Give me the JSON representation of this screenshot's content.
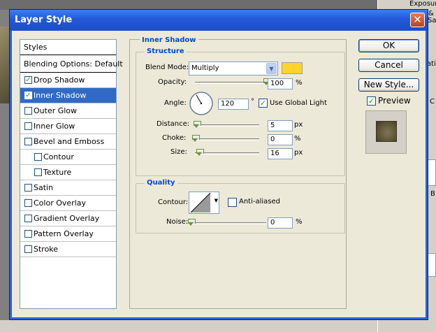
{
  "background": {
    "side_texts": [
      "Exposur",
      "&",
      "Sal",
      "ativ",
      "B",
      "C"
    ]
  },
  "dialog": {
    "title": "Layer Style",
    "close_glyph": "✕"
  },
  "styles_panel": {
    "header": "Styles",
    "blending_options": "Blending Options: Default",
    "items": [
      {
        "label": "Drop Shadow",
        "checked": true,
        "indent": false,
        "selected": false
      },
      {
        "label": "Inner Shadow",
        "checked": true,
        "indent": false,
        "selected": true
      },
      {
        "label": "Outer Glow",
        "checked": false,
        "indent": false,
        "selected": false
      },
      {
        "label": "Inner Glow",
        "checked": false,
        "indent": false,
        "selected": false
      },
      {
        "label": "Bevel and Emboss",
        "checked": false,
        "indent": false,
        "selected": false
      },
      {
        "label": "Contour",
        "checked": false,
        "indent": true,
        "selected": false
      },
      {
        "label": "Texture",
        "checked": false,
        "indent": true,
        "selected": false
      },
      {
        "label": "Satin",
        "checked": false,
        "indent": false,
        "selected": false
      },
      {
        "label": "Color Overlay",
        "checked": false,
        "indent": false,
        "selected": false
      },
      {
        "label": "Gradient Overlay",
        "checked": false,
        "indent": false,
        "selected": false
      },
      {
        "label": "Pattern Overlay",
        "checked": false,
        "indent": false,
        "selected": false
      },
      {
        "label": "Stroke",
        "checked": false,
        "indent": false,
        "selected": false
      }
    ]
  },
  "inner_shadow": {
    "title": "Inner Shadow",
    "structure": {
      "title": "Structure",
      "blend_mode_label": "Blend Mode:",
      "blend_mode_value": "Multiply",
      "color": "#ffd42a",
      "opacity_label": "Opacity:",
      "opacity_value": "100",
      "opacity_unit": "%",
      "opacity_level": 1.0,
      "angle_label": "Angle:",
      "angle_value": "120",
      "angle_unit": "°",
      "angle_degrees": 120,
      "use_global_light_label": "Use Global Light",
      "use_global_light": true,
      "distance_label": "Distance:",
      "distance_value": "5",
      "distance_unit": "px",
      "distance_level": 0.02,
      "choke_label": "Choke:",
      "choke_value": "0",
      "choke_unit": "%",
      "choke_level": 0,
      "size_label": "Size:",
      "size_value": "16",
      "size_unit": "px",
      "size_level": 0.07
    },
    "quality": {
      "title": "Quality",
      "contour_label": "Contour:",
      "anti_aliased_label": "Anti-aliased",
      "anti_aliased": false,
      "noise_label": "Noise:",
      "noise_value": "0",
      "noise_unit": "%",
      "noise_level": 0
    }
  },
  "buttons": {
    "ok": "OK",
    "cancel": "Cancel",
    "new_style": "New Style...",
    "preview_label": "Preview",
    "preview_checked": true
  }
}
